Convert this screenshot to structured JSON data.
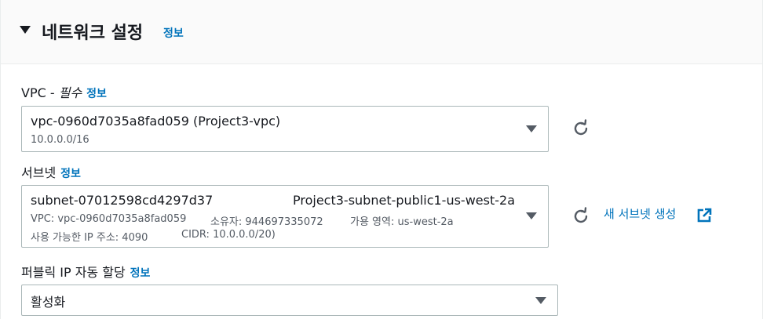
{
  "section": {
    "title": "네트워크 설정",
    "info": "정보"
  },
  "vpc": {
    "label": "VPC - ",
    "required": "필수",
    "info": "정보",
    "selected": "vpc-0960d7035a8fad059 (Project3-vpc)",
    "cidr": "10.0.0.0/16"
  },
  "subnet": {
    "label": "서브넷",
    "info": "정보",
    "selected_id": "subnet-07012598cd4297d37",
    "selected_name": "Project3-subnet-public1-us-west-2a",
    "detail_vpc": "VPC: vpc-0960d7035a8fad059",
    "detail_owner": "소유자: 944697335072",
    "detail_az": "가용 영역: us-west-2a",
    "detail_ips": "사용 가능한 IP 주소: 4090",
    "detail_cidr": "CIDR: 10.0.0.0/20)",
    "create_link": "새 서브넷 생성"
  },
  "public_ip": {
    "label": "퍼블릭 IP 자동 할당",
    "info": "정보",
    "selected": "활성화"
  },
  "icons": {
    "caret": "caret-down-icon",
    "dropdown": "dropdown-triangle-icon",
    "refresh": "refresh-icon",
    "external": "external-link-icon"
  },
  "colors": {
    "link": "#0073bb",
    "text": "#16191f",
    "secondary": "#545b64",
    "border": "#aab7b8",
    "header_bg": "#fafafa"
  }
}
